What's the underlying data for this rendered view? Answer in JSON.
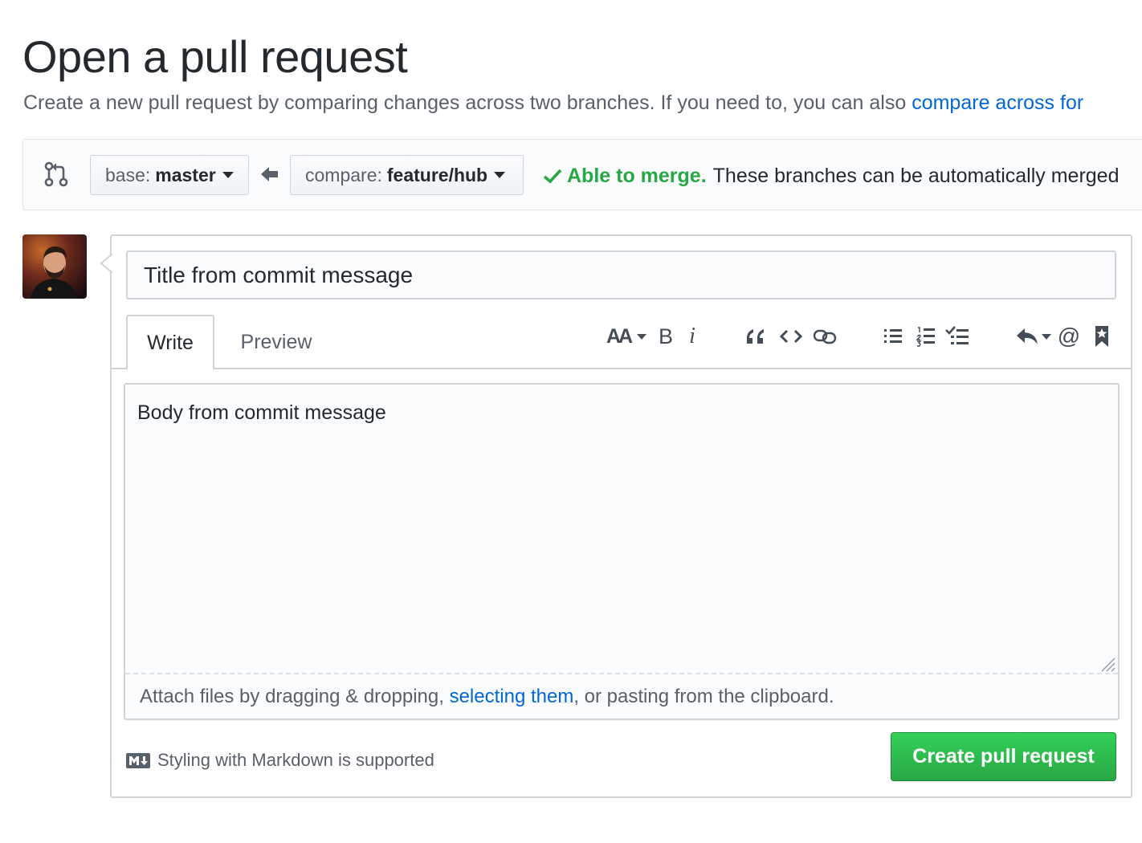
{
  "header": {
    "title": "Open a pull request",
    "subtitle_text": "Create a new pull request by comparing changes across two branches. If you need to, you can also ",
    "subtitle_link": "compare across for"
  },
  "range": {
    "base_label": "base:",
    "base_branch": "master",
    "compare_label": "compare:",
    "compare_branch": "feature/hub",
    "merge_status": "Able to merge.",
    "merge_message": "These branches can be automatically merged"
  },
  "form": {
    "title_value": "Title from commit message",
    "tabs": [
      {
        "label": "Write",
        "selected": true
      },
      {
        "label": "Preview",
        "selected": false
      }
    ],
    "toolbar": [
      "text-size-icon",
      "bold-icon",
      "italic-icon",
      "quote-icon",
      "code-icon",
      "link-icon",
      "bullet-list-icon",
      "numbered-list-icon",
      "task-list-icon",
      "reply-icon",
      "mention-icon",
      "bookmark-icon"
    ],
    "toolbar_text": {
      "text_size": "AA",
      "bold": "B",
      "italic": "i",
      "mention": "@"
    },
    "body_value": "Body from commit message",
    "attach_prefix": "Attach files by dragging & dropping, ",
    "attach_link": "selecting them",
    "attach_suffix": ", or pasting from the clipboard.",
    "markdown_hint": "Styling with Markdown is supported",
    "submit_label": "Create pull request"
  },
  "colors": {
    "success": "#28a745",
    "link": "#0366d6",
    "border": "#d1d5da"
  }
}
